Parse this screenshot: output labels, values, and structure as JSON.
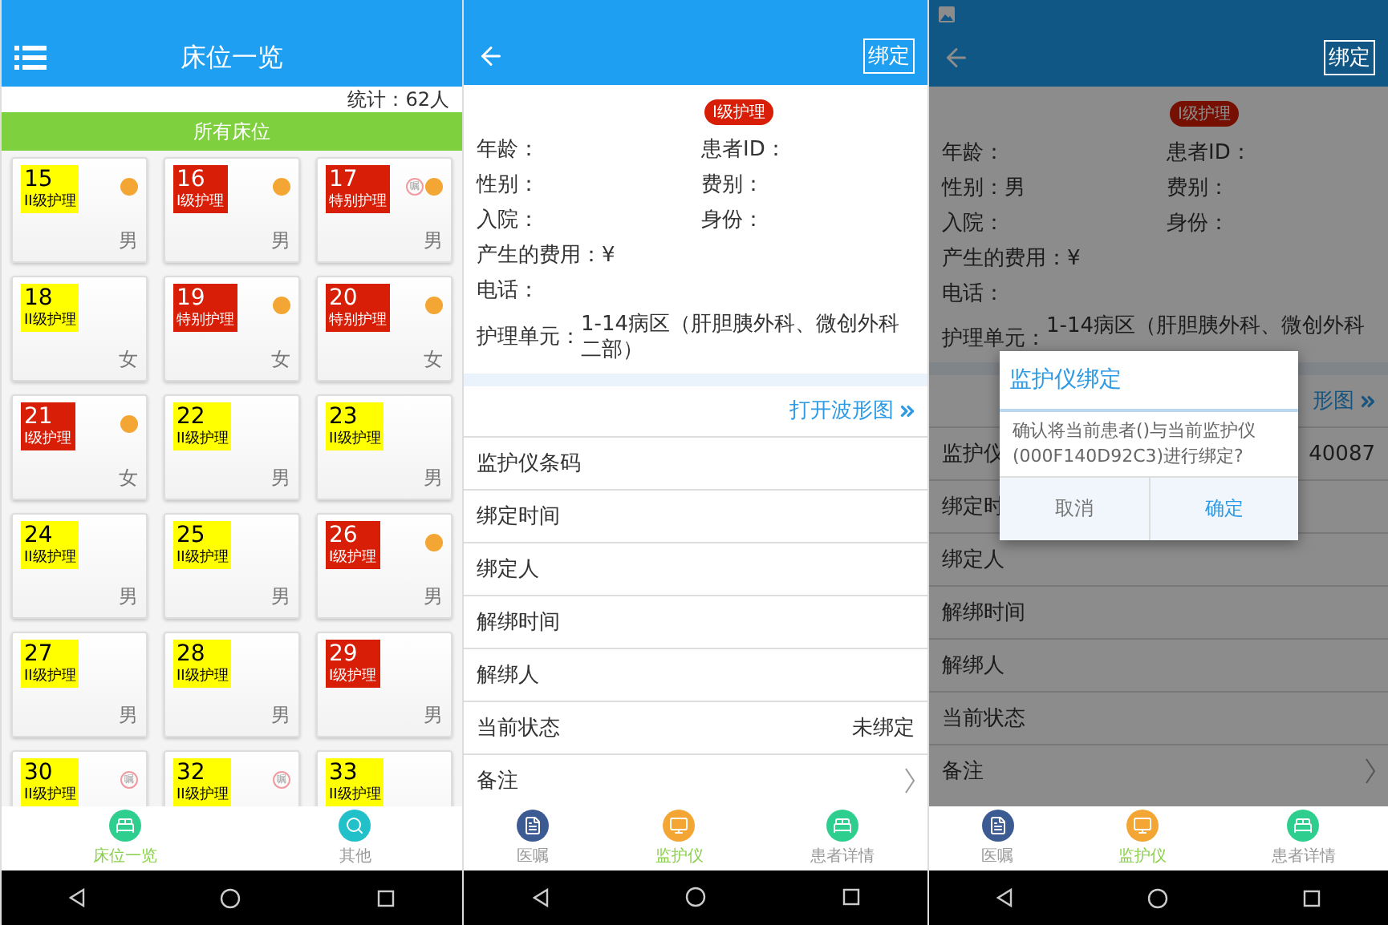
{
  "bed_list": {
    "title": "床位一览",
    "summary": "统计：62人",
    "filter": "所有床位",
    "beds": [
      {
        "number": "15",
        "level": "II级护理",
        "color": "#ffff00",
        "fee": true,
        "gender": "男"
      },
      {
        "number": "16",
        "level": "I级护理",
        "color": "#d81e06",
        "fee": true,
        "gender": "男"
      },
      {
        "number": "17",
        "level": "特别护理",
        "color": "#d81e06",
        "order_badge": "嘱",
        "fee": true,
        "gender": "男"
      },
      {
        "number": "18",
        "level": "II级护理",
        "color": "#ffff00",
        "fee": false,
        "gender": "女"
      },
      {
        "number": "19",
        "level": "特别护理",
        "color": "#d81e06",
        "fee": true,
        "gender": "女"
      },
      {
        "number": "20",
        "level": "特别护理",
        "color": "#d81e06",
        "fee": true,
        "gender": "女"
      },
      {
        "number": "21",
        "level": "I级护理",
        "color": "#d81e06",
        "fee": true,
        "gender": "女"
      },
      {
        "number": "22",
        "level": "II级护理",
        "color": "#ffff00",
        "fee": false,
        "gender": "男"
      },
      {
        "number": "23",
        "level": "II级护理",
        "color": "#ffff00",
        "fee": false,
        "gender": "男"
      },
      {
        "number": "24",
        "level": "II级护理",
        "color": "#ffff00",
        "fee": false,
        "gender": "男"
      },
      {
        "number": "25",
        "level": "II级护理",
        "color": "#ffff00",
        "fee": false,
        "gender": "男"
      },
      {
        "number": "26",
        "level": "I级护理",
        "color": "#d81e06",
        "fee": true,
        "gender": "男"
      },
      {
        "number": "27",
        "level": "II级护理",
        "color": "#ffff00",
        "fee": false,
        "gender": "男"
      },
      {
        "number": "28",
        "level": "II级护理",
        "color": "#ffff00",
        "fee": false,
        "gender": "男"
      },
      {
        "number": "29",
        "level": "I级护理",
        "color": "#d81e06",
        "fee": false,
        "gender": "男"
      },
      {
        "number": "30",
        "level": "II级护理",
        "color": "#ffff00",
        "order_badge": "嘱",
        "fee": false
      },
      {
        "number": "32",
        "level": "II级护理",
        "color": "#ffff00",
        "order_badge": "嘱",
        "fee": false
      },
      {
        "number": "33",
        "level": "II级护理",
        "color": "#ffff00",
        "fee": false
      }
    ],
    "tabs": [
      {
        "label": "床位一览",
        "kind": "beds",
        "selected": true
      },
      {
        "label": "其他",
        "kind": "search",
        "selected": false
      }
    ]
  },
  "monitor_view": {
    "bind_button": "绑定",
    "level_badge": "I级护理",
    "info": [
      [
        {
          "label": "年龄："
        },
        {
          "label": "患者ID："
        }
      ],
      [
        {
          "label": "性别："
        },
        {
          "label": "费别："
        }
      ],
      [
        {
          "label": "入院："
        },
        {
          "label": "身份："
        }
      ],
      [
        {
          "label": "产生的费用：¥"
        }
      ],
      [
        {
          "label": "电话："
        }
      ],
      [
        {
          "label": "护理单元：",
          "value": "1-14病区（肝胆胰外科、微创外科二部）"
        }
      ]
    ],
    "link": "打开波形图",
    "rows": [
      {
        "label": "监护仪条码"
      },
      {
        "label": "绑定时间"
      },
      {
        "label": "绑定人"
      },
      {
        "label": "解绑时间"
      },
      {
        "label": "解绑人"
      },
      {
        "label": "当前状态",
        "value": "未绑定"
      },
      {
        "label": "备注",
        "arrow": true
      }
    ],
    "tabs": [
      {
        "label": "医嘱",
        "kind": "orders",
        "selected": false
      },
      {
        "label": "监护仪",
        "kind": "monitor",
        "selected": true
      },
      {
        "label": "患者详情",
        "kind": "patient",
        "selected": false
      }
    ]
  },
  "bind_dialog_view": {
    "status_icon": true,
    "bind_button": "绑定",
    "level_badge": "I级护理",
    "info": [
      [
        {
          "label": "年龄："
        },
        {
          "label": "患者ID："
        }
      ],
      [
        {
          "label": "性别：",
          "value": "男"
        },
        {
          "label": "费别："
        }
      ],
      [
        {
          "label": "入院："
        },
        {
          "label": "身份："
        }
      ],
      [
        {
          "label": "产生的费用：¥"
        }
      ],
      [
        {
          "label": "电话："
        }
      ],
      [
        {
          "label": "护理单元：",
          "value": "1-14病区（肝胆胰外科、微创外科"
        }
      ]
    ],
    "link": "形图",
    "rows": [
      {
        "label": "监护仪",
        "value": "40087"
      },
      {
        "label": "绑定时"
      },
      {
        "label": "绑定人"
      },
      {
        "label": "解绑时间"
      },
      {
        "label": "解绑人"
      },
      {
        "label": "当前状态"
      },
      {
        "label": "备注",
        "arrow": true
      }
    ],
    "tabs": [
      {
        "label": "医嘱",
        "kind": "orders",
        "selected": false
      },
      {
        "label": "监护仪",
        "kind": "monitor",
        "selected": true
      },
      {
        "label": "患者详情",
        "kind": "patient",
        "selected": false
      }
    ],
    "dialog": {
      "title": "监护仪绑定",
      "message": "确认将当前患者()与当前监护仪(000F140D92C3)进行绑定?",
      "buttons": [
        {
          "label": "取消",
          "primary": false
        },
        {
          "label": "确定",
          "primary": true
        }
      ]
    }
  }
}
